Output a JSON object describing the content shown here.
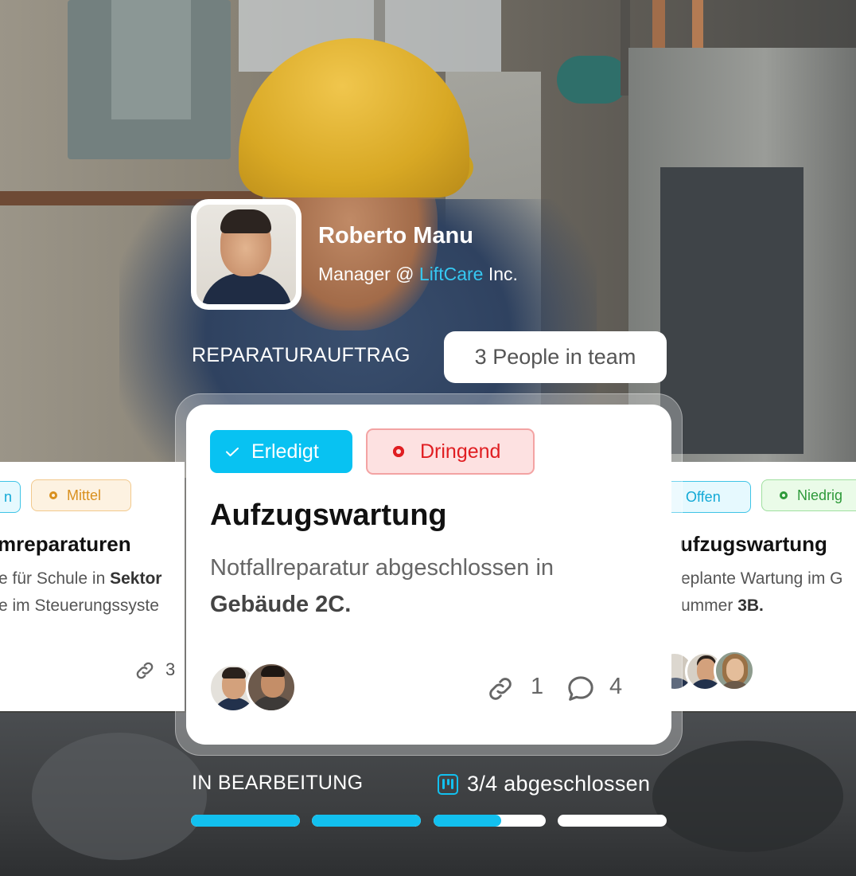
{
  "profile": {
    "name": "Roberto Manu",
    "role_prefix": "Manager @ ",
    "company": "LiftCare",
    "company_suffix": " Inc."
  },
  "order": {
    "label": "REPARATURAUFTRAG",
    "team_pill": "3 People in team"
  },
  "main_card": {
    "status_badge": "Erledigt",
    "priority_badge": "Dringend",
    "title": "Aufzugswartung",
    "description_line1": "Notfallreparatur abgeschlossen in",
    "description_bold": "Gebäude 2C.",
    "attachments_count": "1",
    "comments_count": "4"
  },
  "left_card": {
    "status_badge_partial": "n",
    "priority_badge": "Mittel",
    "title_partial": "mreparaturen",
    "line1_prefix": "e für Schule in ",
    "line1_bold": "Sektor",
    "line2": "e im Steuerungssyste",
    "attachments_partial": "3"
  },
  "right_card": {
    "status_badge": "Offen",
    "priority_badge": "Niedrig",
    "title_partial": "ufzugswartung",
    "line1": "eplante Wartung im G",
    "line2_prefix": "ummer ",
    "line2_bold": "3B."
  },
  "progress": {
    "label": "IN BEARBEITUNG",
    "summary": "3/4 abgeschlossen",
    "segments": [
      1,
      1,
      0.6,
      0
    ]
  },
  "colors": {
    "accent": "#08c2f2",
    "urgent": "#e01e22",
    "urgent_bg": "#fde1e1",
    "medium": "#d9901e",
    "low": "#2e9a3a"
  },
  "icons": [
    "check-icon",
    "dot-icon",
    "link-icon",
    "comment-icon",
    "kanban-icon"
  ]
}
